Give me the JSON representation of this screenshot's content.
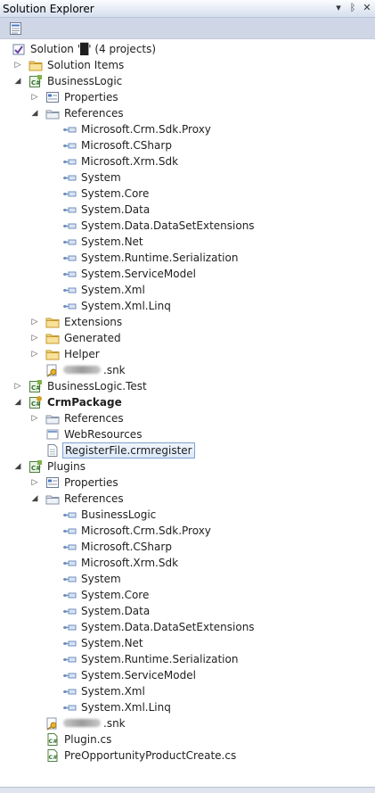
{
  "window": {
    "title": "Solution Explorer",
    "controls": [
      "▾",
      "ᛒ",
      "✕"
    ]
  },
  "toolbar": {
    "buttons": [
      "properties-icon"
    ]
  },
  "tree": [
    {
      "label": "Solution '█' (4 projects)",
      "level": 0,
      "expander": "none",
      "icon": "solution",
      "bold": false
    },
    {
      "label": "Solution Items",
      "level": 1,
      "expander": "collapsed",
      "icon": "folder",
      "bold": false
    },
    {
      "label": "BusinessLogic",
      "level": 1,
      "expander": "expanded",
      "icon": "csproj",
      "bold": false
    },
    {
      "label": "Properties",
      "level": 2,
      "expander": "collapsed",
      "icon": "properties",
      "bold": false
    },
    {
      "label": "References",
      "level": 2,
      "expander": "expanded",
      "icon": "references",
      "bold": false
    },
    {
      "label": "Microsoft.Crm.Sdk.Proxy",
      "level": 3,
      "expander": "none",
      "icon": "reference",
      "bold": false
    },
    {
      "label": "Microsoft.CSharp",
      "level": 3,
      "expander": "none",
      "icon": "reference",
      "bold": false
    },
    {
      "label": "Microsoft.Xrm.Sdk",
      "level": 3,
      "expander": "none",
      "icon": "reference",
      "bold": false
    },
    {
      "label": "System",
      "level": 3,
      "expander": "none",
      "icon": "reference",
      "bold": false
    },
    {
      "label": "System.Core",
      "level": 3,
      "expander": "none",
      "icon": "reference",
      "bold": false
    },
    {
      "label": "System.Data",
      "level": 3,
      "expander": "none",
      "icon": "reference",
      "bold": false
    },
    {
      "label": "System.Data.DataSetExtensions",
      "level": 3,
      "expander": "none",
      "icon": "reference",
      "bold": false
    },
    {
      "label": "System.Net",
      "level": 3,
      "expander": "none",
      "icon": "reference",
      "bold": false
    },
    {
      "label": "System.Runtime.Serialization",
      "level": 3,
      "expander": "none",
      "icon": "reference",
      "bold": false
    },
    {
      "label": "System.ServiceModel",
      "level": 3,
      "expander": "none",
      "icon": "reference",
      "bold": false
    },
    {
      "label": "System.Xml",
      "level": 3,
      "expander": "none",
      "icon": "reference",
      "bold": false
    },
    {
      "label": "System.Xml.Linq",
      "level": 3,
      "expander": "none",
      "icon": "reference",
      "bold": false
    },
    {
      "label": "Extensions",
      "level": 2,
      "expander": "collapsed",
      "icon": "folder",
      "bold": false
    },
    {
      "label": "Generated",
      "level": 2,
      "expander": "collapsed",
      "icon": "folder",
      "bold": false
    },
    {
      "label": "Helper",
      "level": 2,
      "expander": "collapsed",
      "icon": "folder",
      "bold": false
    },
    {
      "label": ".snk",
      "level": 2,
      "expander": "none",
      "icon": "key",
      "bold": false,
      "blurred": true
    },
    {
      "label": "BusinessLogic.Test",
      "level": 1,
      "expander": "collapsed",
      "icon": "csproj",
      "bold": false
    },
    {
      "label": "CrmPackage",
      "level": 1,
      "expander": "expanded",
      "icon": "crmpackage",
      "bold": true
    },
    {
      "label": "References",
      "level": 2,
      "expander": "collapsed",
      "icon": "references",
      "bold": false
    },
    {
      "label": "WebResources",
      "level": 2,
      "expander": "none",
      "icon": "webres",
      "bold": false
    },
    {
      "label": "RegisterFile.crmregister",
      "level": 2,
      "expander": "none",
      "icon": "file",
      "bold": false,
      "selected": true
    },
    {
      "label": "Plugins",
      "level": 1,
      "expander": "expanded",
      "icon": "csproj",
      "bold": false
    },
    {
      "label": "Properties",
      "level": 2,
      "expander": "collapsed",
      "icon": "properties",
      "bold": false
    },
    {
      "label": "References",
      "level": 2,
      "expander": "expanded",
      "icon": "references",
      "bold": false
    },
    {
      "label": "BusinessLogic",
      "level": 3,
      "expander": "none",
      "icon": "reference",
      "bold": false
    },
    {
      "label": "Microsoft.Crm.Sdk.Proxy",
      "level": 3,
      "expander": "none",
      "icon": "reference",
      "bold": false
    },
    {
      "label": "Microsoft.CSharp",
      "level": 3,
      "expander": "none",
      "icon": "reference",
      "bold": false
    },
    {
      "label": "Microsoft.Xrm.Sdk",
      "level": 3,
      "expander": "none",
      "icon": "reference",
      "bold": false
    },
    {
      "label": "System",
      "level": 3,
      "expander": "none",
      "icon": "reference",
      "bold": false
    },
    {
      "label": "System.Core",
      "level": 3,
      "expander": "none",
      "icon": "reference",
      "bold": false
    },
    {
      "label": "System.Data",
      "level": 3,
      "expander": "none",
      "icon": "reference",
      "bold": false
    },
    {
      "label": "System.Data.DataSetExtensions",
      "level": 3,
      "expander": "none",
      "icon": "reference",
      "bold": false
    },
    {
      "label": "System.Net",
      "level": 3,
      "expander": "none",
      "icon": "reference",
      "bold": false
    },
    {
      "label": "System.Runtime.Serialization",
      "level": 3,
      "expander": "none",
      "icon": "reference",
      "bold": false
    },
    {
      "label": "System.ServiceModel",
      "level": 3,
      "expander": "none",
      "icon": "reference",
      "bold": false
    },
    {
      "label": "System.Xml",
      "level": 3,
      "expander": "none",
      "icon": "reference",
      "bold": false
    },
    {
      "label": "System.Xml.Linq",
      "level": 3,
      "expander": "none",
      "icon": "reference",
      "bold": false
    },
    {
      "label": ".snk",
      "level": 2,
      "expander": "none",
      "icon": "key",
      "bold": false,
      "blurred": true
    },
    {
      "label": "Plugin.cs",
      "level": 2,
      "expander": "none",
      "icon": "csfile",
      "bold": false
    },
    {
      "label": "PreOpportunityProductCreate.cs",
      "level": 2,
      "expander": "none",
      "icon": "csfile",
      "bold": false
    }
  ]
}
